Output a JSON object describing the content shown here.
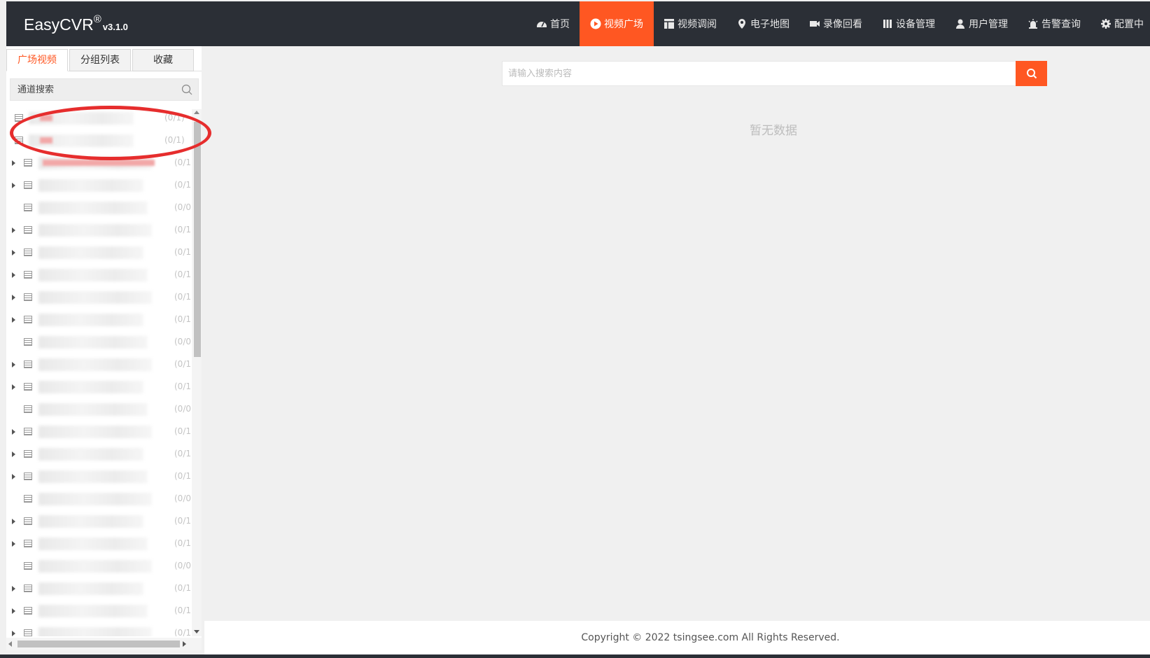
{
  "header": {
    "brand": "EasyCVR",
    "registered": "®",
    "version": "v3.1.0",
    "nav": [
      {
        "label": "首页",
        "icon": "dashboard-icon",
        "active": false
      },
      {
        "label": "视频广场",
        "icon": "play-circle-icon",
        "active": true
      },
      {
        "label": "视频调阅",
        "icon": "table-icon",
        "active": false
      },
      {
        "label": "电子地图",
        "icon": "map-pin-icon",
        "active": false
      },
      {
        "label": "录像回看",
        "icon": "video-camera-icon",
        "active": false
      },
      {
        "label": "设备管理",
        "icon": "columns-icon",
        "active": false
      },
      {
        "label": "用户管理",
        "icon": "user-icon",
        "active": false
      },
      {
        "label": "告警查询",
        "icon": "alarm-icon",
        "active": false
      },
      {
        "label": "配置中",
        "icon": "gear-icon",
        "active": false
      }
    ]
  },
  "sidebar": {
    "tabs": [
      "广场视频",
      "分组列表",
      "收藏"
    ],
    "search_placeholder": "通道搜索",
    "tree_counts": [
      "(0/1)",
      "(0/1)",
      "(0/1",
      "(0/1",
      "(0/0",
      "(0/1",
      "(0/1",
      "(0/1",
      "(0/1",
      "(0/1",
      "(0/0",
      "(0/1",
      "(0/1",
      "(0/0",
      "(0/1",
      "(0/1",
      "(0/1",
      "(0/0",
      "(0/1",
      "(0/1",
      "(0/0",
      "(0/1",
      "(0/1",
      "(0/1"
    ]
  },
  "main": {
    "search_placeholder": "请输入搜索内容",
    "empty_text": "暂无数据"
  },
  "footer": {
    "copyright": "Copyright © 2022 tsingsee.com All Rights Reserved."
  },
  "colors": {
    "accent": "#ff5722",
    "header_bg": "#2b2f36",
    "annotation": "#e62d2d"
  }
}
